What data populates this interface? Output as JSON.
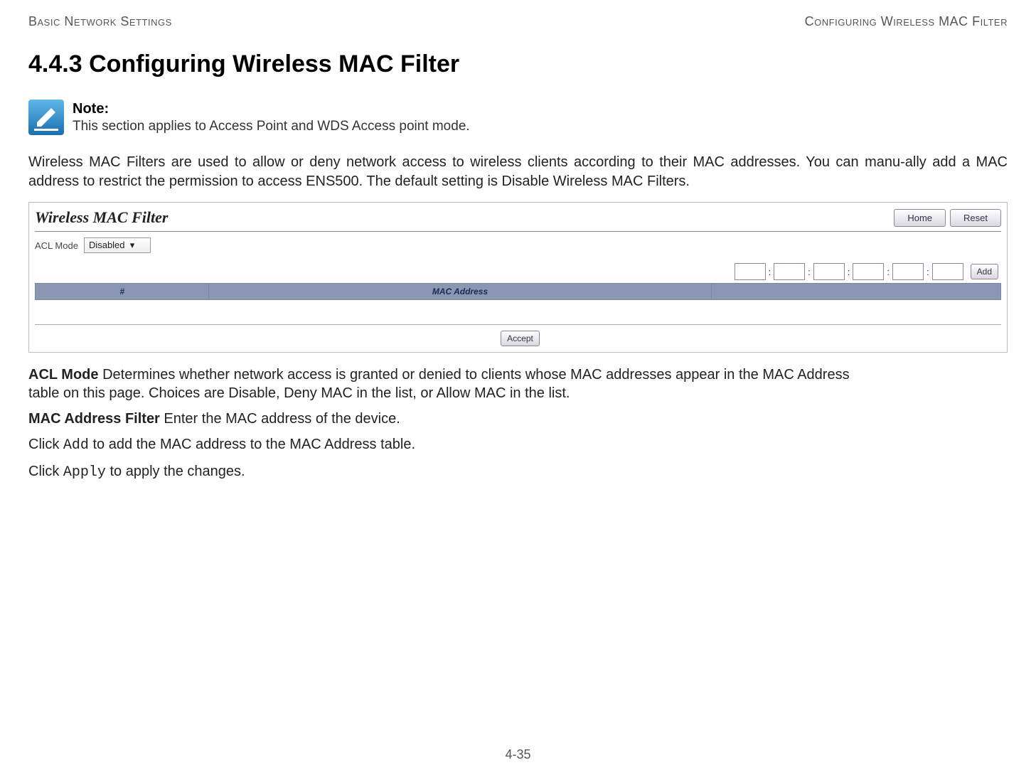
{
  "header": {
    "left": "Basic Network Settings",
    "right": "Configuring Wireless MAC Filter"
  },
  "heading": "4.4.3 Configuring Wireless MAC Filter",
  "note": {
    "label": "Note:",
    "text": "This section applies to Access Point and WDS Access point mode."
  },
  "intro": "Wireless MAC Filters are used to allow or deny network access to wireless clients according to their MAC addresses. You can manu-ally add a MAC address to restrict the permission to access ENS500. The default setting is Disable Wireless MAC Filters.",
  "screenshot": {
    "title": "Wireless MAC Filter",
    "home_btn": "Home",
    "reset_btn": "Reset",
    "acl_label": "ACL Mode",
    "acl_value": "Disabled",
    "separator": ":",
    "add_btn": "Add",
    "col_hash": "#",
    "col_mac": "MAC Address",
    "col_blank": "",
    "accept_btn": "Accept"
  },
  "defs": {
    "acl_term": "ACL Mode",
    "acl_desc1": "  Determines whether network access is granted or denied to clients whose MAC addresses appear in the MAC Address",
    "acl_desc2": "table on this page. Choices are Disable, Deny MAC in the list, or Allow MAC in the list.",
    "macfilter_term": "MAC Address Filter",
    "macfilter_desc": "  Enter the MAC address of the device.",
    "add_pre": "Click ",
    "add_code": "Add",
    "add_post": " to add the MAC address to the MAC Address table.",
    "apply_pre": "Click ",
    "apply_code": "Apply",
    "apply_post": " to apply the changes."
  },
  "page_number": "4-35"
}
